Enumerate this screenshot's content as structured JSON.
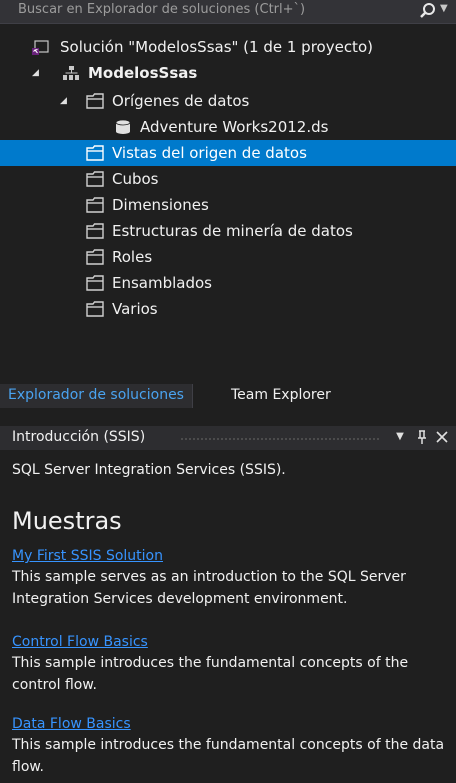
{
  "search": {
    "placeholder": "Buscar en Explorador de soluciones (Ctrl+`)"
  },
  "tree": {
    "solution": "Solución \"ModelosSsas\" (1 de 1 proyecto)",
    "project": "ModelosSsas",
    "data_sources": "Orígenes de datos",
    "data_source_file": "Adventure Works2012.ds",
    "data_source_views": "Vistas del origen de datos",
    "cubes": "Cubos",
    "dimensions": "Dimensiones",
    "mining_structures": "Estructuras de minería de datos",
    "roles": "Roles",
    "assemblies": "Ensamblados",
    "misc": "Varios"
  },
  "tabs": {
    "solution_explorer": "Explorador de soluciones",
    "team_explorer": "Team Explorer"
  },
  "intro_panel": {
    "title": "Introducción (SSIS)",
    "intro_text": "SQL Server Integration Services (SSIS).",
    "heading": "Muestras",
    "samples": [
      {
        "link": "My First SSIS Solution",
        "desc": "This sample serves as an introduction to the SQL Server Integration Services development environment."
      },
      {
        "link": "Control Flow Basics",
        "desc": "This sample introduces the fundamental concepts of the control flow."
      },
      {
        "link": "Data Flow Basics",
        "desc": "This sample introduces the fundamental concepts of the data flow."
      }
    ]
  },
  "colors": {
    "selection": "#007acc",
    "link": "#3794ff",
    "background": "#1f1f1f"
  }
}
